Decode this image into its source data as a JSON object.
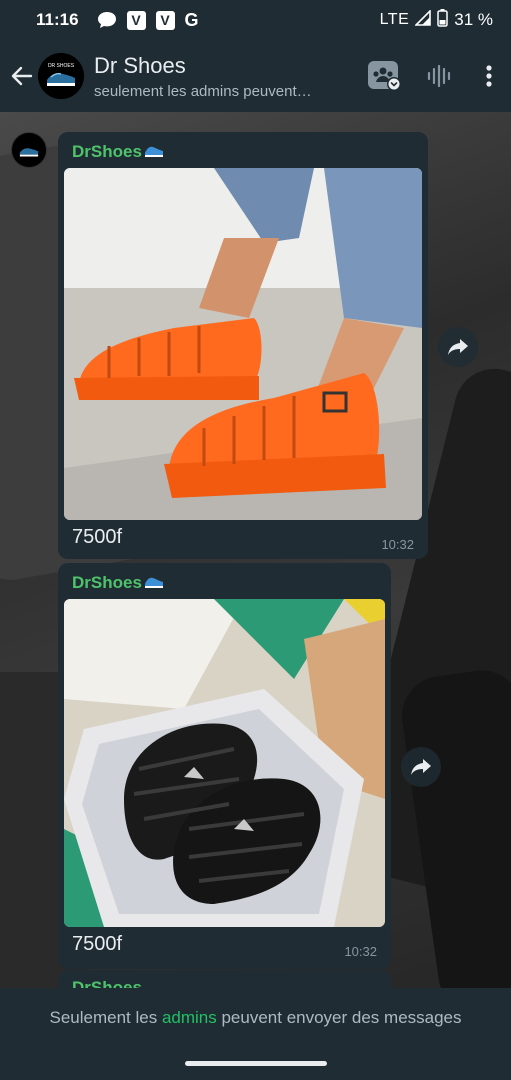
{
  "status_bar": {
    "time": "11:16",
    "network": "LTE",
    "battery": "31 %",
    "notif_icons": [
      "chat-bubble-icon",
      "v-app-icon",
      "v-app-icon",
      "google-icon"
    ],
    "g_label": "G",
    "v_label": "V"
  },
  "header": {
    "title": "Dr Shoes",
    "subtitle": "seulement les admins peuvent…",
    "avatar_label": "DR SHOES"
  },
  "messages": [
    {
      "sender": "DrShoes",
      "sender_emoji": "shoe-emoji",
      "image_desc": "orange-platform-sandals-photo",
      "caption": "7500f",
      "time": "10:32"
    },
    {
      "sender": "DrShoes",
      "sender_emoji": "shoe-emoji",
      "image_desc": "black-platform-sandals-in-box-photo",
      "caption": "7500f",
      "time": "10:32"
    }
  ],
  "peek": {
    "sender": "DrShoes"
  },
  "footer": {
    "prefix": "Seulement les ",
    "link": "admins",
    "suffix": " peuvent envoyer des messages"
  },
  "colors": {
    "accent_green": "#21c063",
    "sender_green": "#4fc36a",
    "bubble": "#1f2c34",
    "header": "#1f2c34"
  }
}
